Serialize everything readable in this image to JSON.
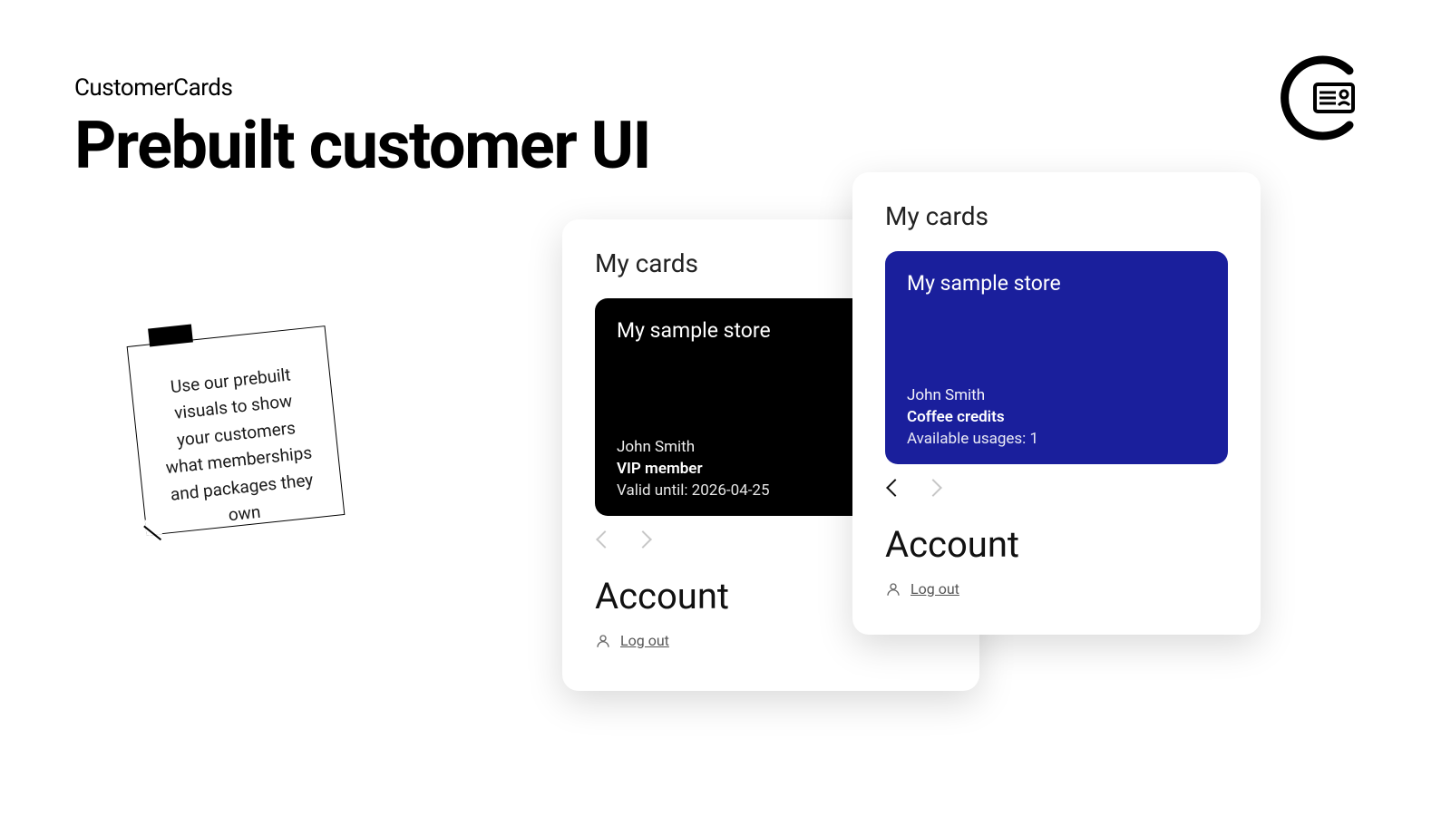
{
  "brand": "CustomerCards",
  "title": "Prebuilt customer UI",
  "note_text": "Use our prebuilt visuals to show your customers what memberships and packages they own",
  "panels": {
    "a": {
      "section": "My cards",
      "card": {
        "store": "My sample store",
        "customer": "John Smith",
        "label": "VIP member",
        "meta": "Valid until: 2026-04-25"
      },
      "account_heading": "Account",
      "logout": "Log out"
    },
    "b": {
      "section": "My cards",
      "card": {
        "store": "My sample store",
        "customer": "John Smith",
        "label": "Coffee credits",
        "meta": "Available usages: 1"
      },
      "account_heading": "Account",
      "logout": "Log out"
    }
  },
  "colors": {
    "card_black": "#000000",
    "card_blue": "#1a1f9c"
  }
}
